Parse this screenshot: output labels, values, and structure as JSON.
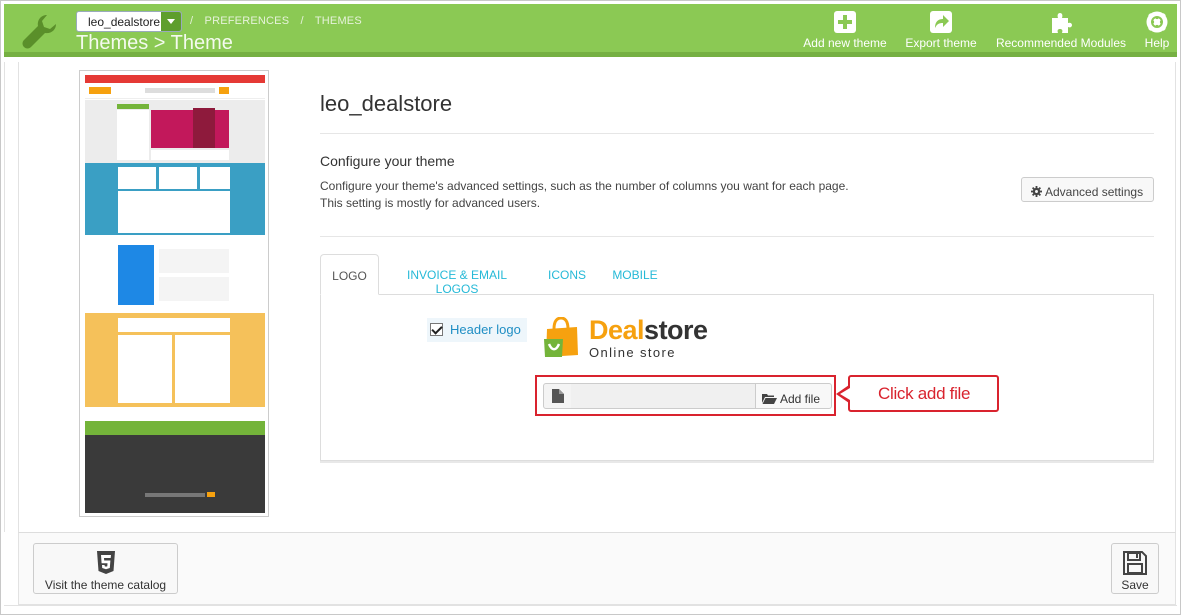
{
  "header": {
    "shop_selector": "leo_dealstore",
    "breadcrumb": [
      "PREFERENCES",
      "THEMES"
    ],
    "title": "Themes > Theme",
    "toolbar": [
      {
        "label": "Add new theme",
        "icon": "plus-icon"
      },
      {
        "label": "Export theme",
        "icon": "export-icon"
      },
      {
        "label": "Recommended Modules",
        "icon": "puzzle-icon"
      },
      {
        "label": "Help",
        "icon": "lifebuoy-icon"
      }
    ]
  },
  "theme": {
    "name": "leo_dealstore",
    "configure_title": "Configure your theme",
    "configure_description": "Configure your theme's advanced settings, such as the number of columns you want for each page. This setting is mostly for advanced users.",
    "advanced_settings_label": "Advanced settings"
  },
  "tabs": [
    {
      "label": "LOGO",
      "active": true
    },
    {
      "label": "INVOICE & EMAIL LOGOS",
      "active": false
    },
    {
      "label": "ICONS",
      "active": false
    },
    {
      "label": "MOBILE",
      "active": false
    }
  ],
  "logo_tab": {
    "header_logo_label": "Header logo",
    "header_logo_checked": true,
    "logo_brand_part1": "Deal",
    "logo_brand_part2": "store",
    "logo_tagline": "Online store",
    "add_file_label": "Add file",
    "file_value": ""
  },
  "annotation": {
    "callout_text": "Click add file",
    "color": "#d9232e"
  },
  "footer": {
    "catalog_label": "Visit the theme catalog",
    "save_label": "Save"
  },
  "colors": {
    "header_green": "#8bc954",
    "link_blue": "#25b9d7",
    "logo_orange": "#f6a10f"
  }
}
